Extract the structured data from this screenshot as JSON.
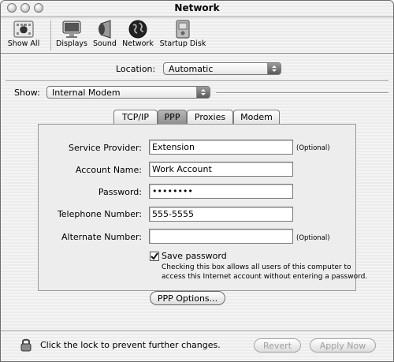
{
  "window": {
    "title": "Network"
  },
  "toolbar": {
    "items": [
      {
        "label": "Show All",
        "icon": "apple-icon"
      },
      {
        "label": "Displays",
        "icon": "display-icon"
      },
      {
        "label": "Sound",
        "icon": "speaker-icon"
      },
      {
        "label": "Network",
        "icon": "globe-icon"
      },
      {
        "label": "Startup Disk",
        "icon": "disk-icon"
      }
    ]
  },
  "location": {
    "label": "Location:",
    "value": "Automatic"
  },
  "show": {
    "label": "Show:",
    "value": "Internal Modem"
  },
  "tabs": [
    {
      "label": "TCP/IP",
      "active": false
    },
    {
      "label": "PPP",
      "active": true
    },
    {
      "label": "Proxies",
      "active": false
    },
    {
      "label": "Modem",
      "active": false
    }
  ],
  "ppp": {
    "service_provider": {
      "label": "Service Provider:",
      "value": "Extension",
      "note": "(Optional)"
    },
    "account_name": {
      "label": "Account Name:",
      "value": "Work Account"
    },
    "password": {
      "label": "Password:",
      "value": "••••••••"
    },
    "telephone": {
      "label": "Telephone Number:",
      "value": "555-5555"
    },
    "alternate": {
      "label": "Alternate Number:",
      "value": "",
      "note": "(Optional)"
    },
    "save_password": {
      "label": "Save password",
      "checked": true,
      "hint_line1": "Checking this box allows all users of this computer to",
      "hint_line2": "access this Internet account without entering a password."
    },
    "options_button": "PPP Options..."
  },
  "footer": {
    "lock_text": "Click the lock to prevent further changes.",
    "revert_button": "Revert",
    "apply_button": "Apply Now"
  }
}
